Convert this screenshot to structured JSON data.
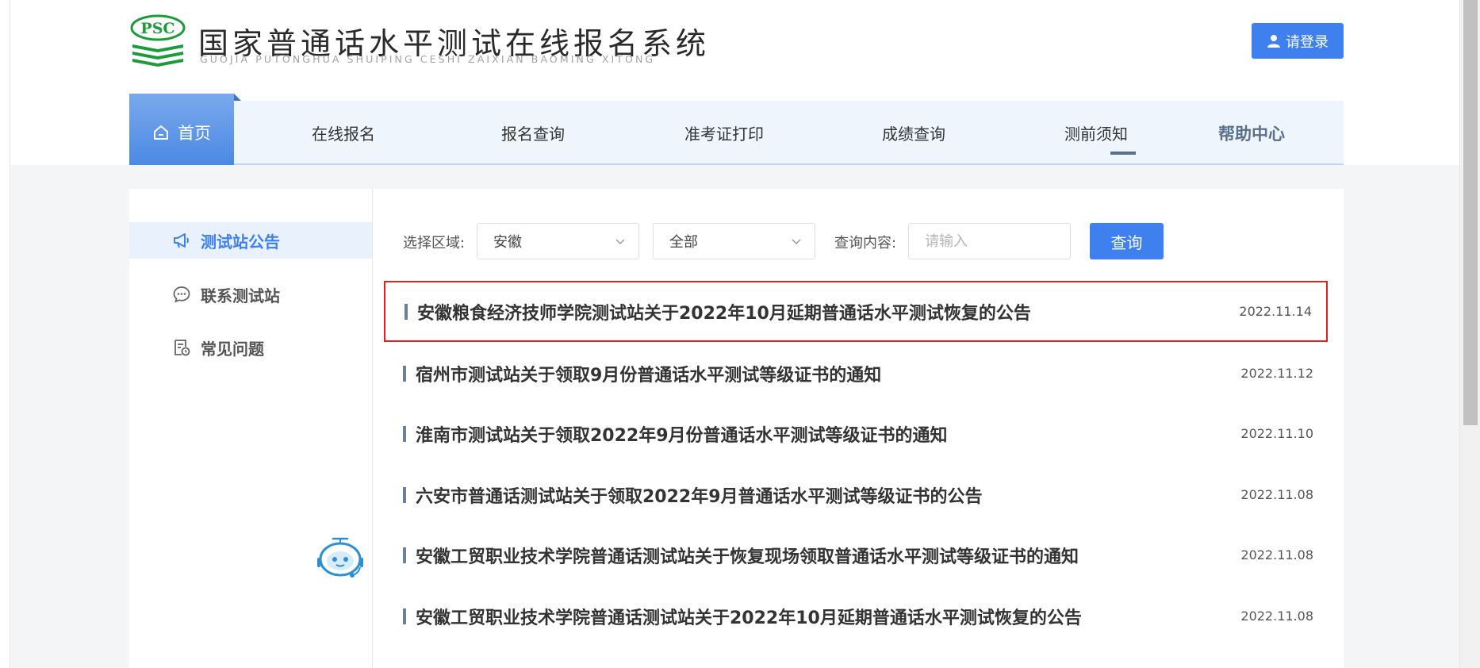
{
  "header": {
    "logo_text": "PSC",
    "title": "国家普通话水平测试在线报名系统",
    "subtitle": "GUOJIA PUTONGHUA SHUIPING CESHI ZAIXIAN BAOMING XITONG",
    "login_label": "请登录",
    "login_icon": "user-icon"
  },
  "nav": {
    "home_label": "首页",
    "home_icon": "home-icon",
    "items": [
      {
        "label": "在线报名"
      },
      {
        "label": "报名查询"
      },
      {
        "label": "准考证打印"
      },
      {
        "label": "成绩查询"
      },
      {
        "label": "测前须知"
      },
      {
        "label": "帮助中心",
        "active": true
      }
    ]
  },
  "sidebar": {
    "items": [
      {
        "label": "测试站公告",
        "icon": "megaphone-icon",
        "active": true
      },
      {
        "label": "联系测试站",
        "icon": "chat-bubble-icon"
      },
      {
        "label": "常见问题",
        "icon": "faq-document-icon"
      }
    ]
  },
  "filters": {
    "region_label": "选择区域:",
    "region_value": "安徽",
    "scope_value": "全部",
    "query_label": "查询内容:",
    "query_placeholder": "请输入",
    "query_button": "查询"
  },
  "notices": [
    {
      "title": "安徽粮食经济技师学院测试站关于2022年10月延期普通话水平测试恢复的公告",
      "date": "2022.11.14",
      "highlighted": true
    },
    {
      "title": "宿州市测试站关于领取9月份普通话水平测试等级证书的通知",
      "date": "2022.11.12"
    },
    {
      "title": "淮南市测试站关于领取2022年9月份普通话水平测试等级证书的通知",
      "date": "2022.11.10"
    },
    {
      "title": "六安市普通话测试站关于领取2022年9月普通话水平测试等级证书的公告",
      "date": "2022.11.08"
    },
    {
      "title": "安徽工贸职业技术学院普通话测试站关于恢复现场领取普通话水平测试等级证书的通知",
      "date": "2022.11.08"
    },
    {
      "title": "安徽工贸职业技术学院普通话测试站关于2022年10月延期普通话水平测试恢复的公告",
      "date": "2022.11.08"
    }
  ],
  "colors": {
    "primary": "#3d80ee",
    "highlight_border": "#e41c24",
    "logo_green": "#1e9a3c",
    "active_nav": "#5b6f8d"
  }
}
